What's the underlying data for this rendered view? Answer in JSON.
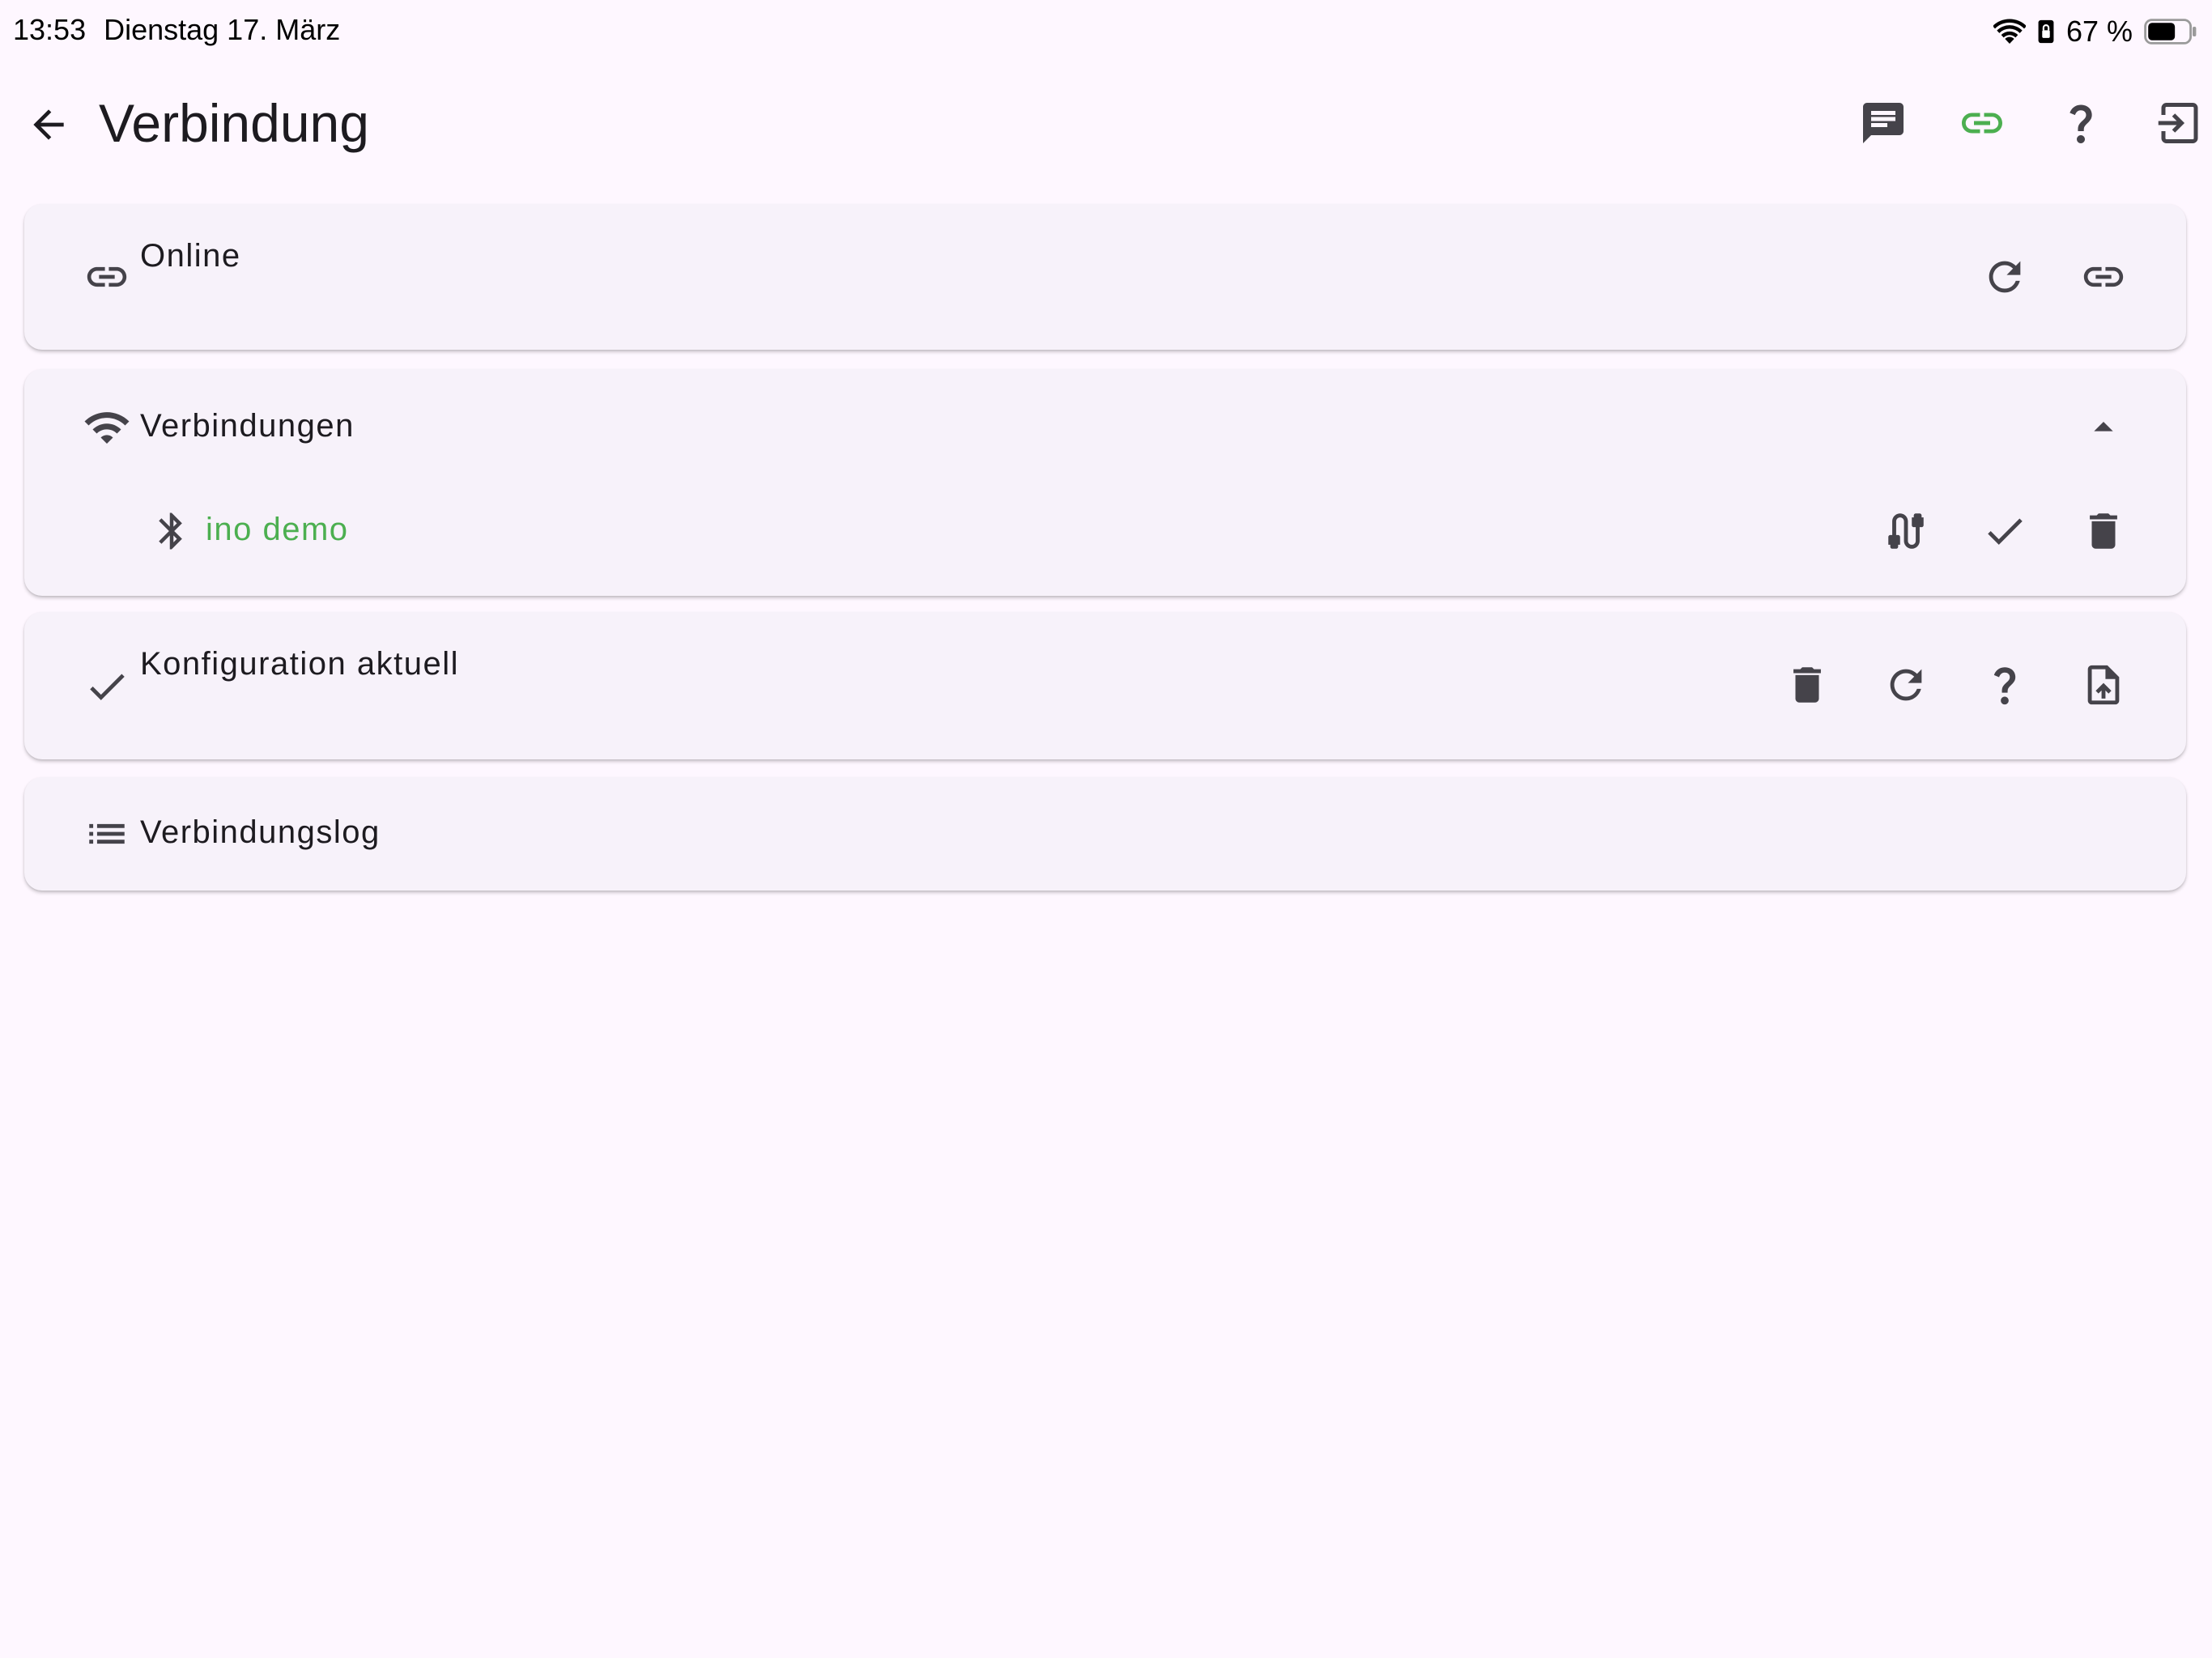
{
  "status_bar": {
    "time": "13:53",
    "date": "Dienstag 17. März",
    "battery_percent_text": "67 %",
    "battery_level": 0.67,
    "icons": [
      "wifi-icon",
      "sim-lock-icon",
      "battery-icon"
    ]
  },
  "app_bar": {
    "title": "Verbindung",
    "back_icon": "arrow-back-icon",
    "actions": [
      "message-icon",
      "link-icon",
      "help-icon",
      "logout-icon"
    ]
  },
  "cards": {
    "online": {
      "label": "Online",
      "lead_icon": "link-icon",
      "actions": [
        "refresh-icon",
        "link-icon"
      ]
    },
    "connections": {
      "label": "Verbindungen",
      "lead_icon": "wifi-icon",
      "toggle_icon": "arrow-drop-up-icon",
      "device": {
        "name": "ino demo",
        "icon": "bluetooth-icon",
        "actions": [
          "cable-icon",
          "check-icon",
          "delete-icon"
        ]
      }
    },
    "config": {
      "label": "Konfiguration aktuell",
      "lead_icon": "check-icon",
      "actions": [
        "delete-icon",
        "refresh-icon",
        "help-icon",
        "upload-file-icon"
      ]
    },
    "log": {
      "label": "Verbindungslog",
      "lead_icon": "list-icon"
    }
  },
  "colors": {
    "background": "#FEF7FF",
    "card": "#F7F2FA",
    "accent_green": "#4CAF50",
    "icon": "#45434A",
    "text": "#1D1B20"
  }
}
